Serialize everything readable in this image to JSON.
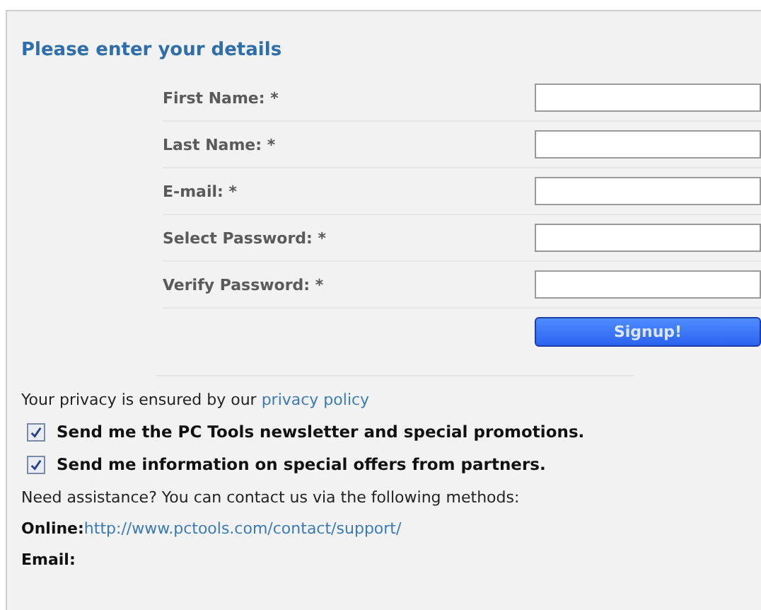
{
  "form": {
    "heading": "Please enter your details",
    "fields": [
      {
        "label": "First Name: *"
      },
      {
        "label": "Last Name: *"
      },
      {
        "label": "E-mail: *"
      },
      {
        "label": "Select Password: *"
      },
      {
        "label": "Verify Password: *"
      }
    ],
    "submit": "Signup!"
  },
  "privacy": {
    "text": "Your privacy is ensured by our",
    "link": "privacy policy"
  },
  "options": [
    {
      "label": "Send me the PC Tools newsletter and special promotions.",
      "checked": true
    },
    {
      "label": "Send me information on special offers from partners.",
      "checked": true
    }
  ],
  "assistance": "Need assistance? You can contact us via the following methods:",
  "contacts": [
    {
      "label": "Online:",
      "link": "http://www.pctools.com/contact/support/"
    },
    {
      "label": "Email:"
    }
  ]
}
